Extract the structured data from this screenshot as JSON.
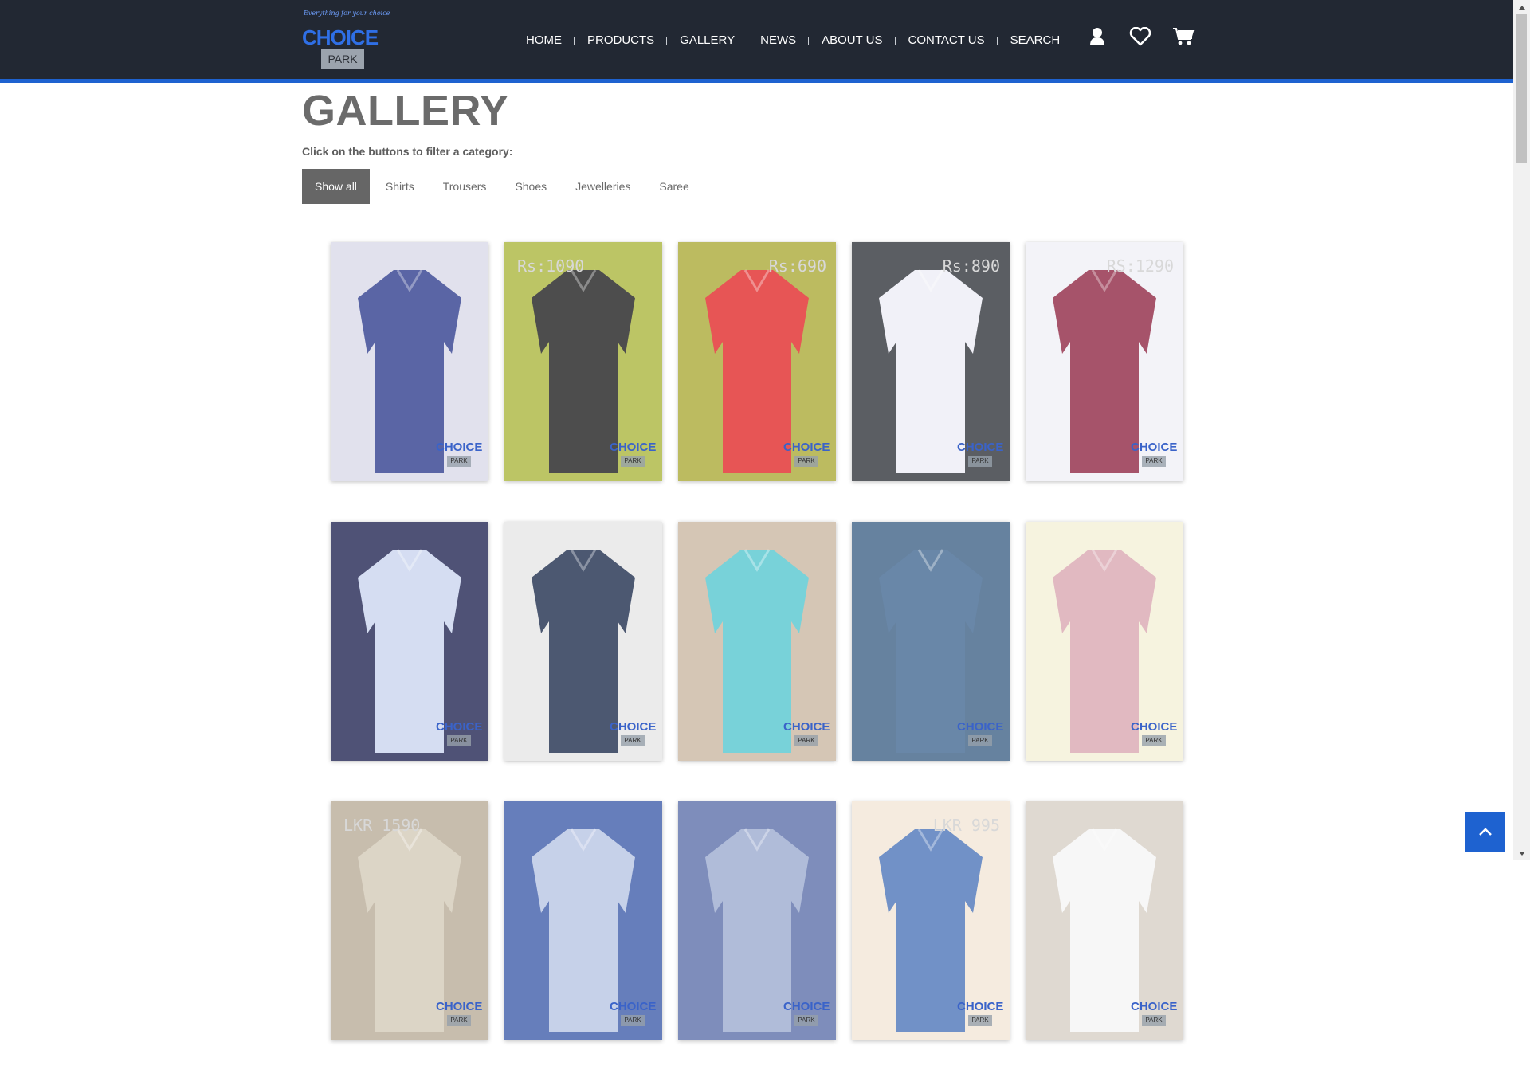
{
  "brand": {
    "tagline": "Everything for your choice",
    "name_primary": "CHOICE",
    "name_secondary": "PARK"
  },
  "nav": {
    "items": [
      {
        "label": "HOME"
      },
      {
        "label": "PRODUCTS"
      },
      {
        "label": "GALLERY"
      },
      {
        "label": "NEWS"
      },
      {
        "label": "ABOUT US"
      },
      {
        "label": "CONTACT US"
      },
      {
        "label": "SEARCH"
      }
    ],
    "icons": [
      "user-icon",
      "heart-icon",
      "cart-icon"
    ]
  },
  "page": {
    "title": "GALLERY",
    "filter_prompt": "Click on the buttons to filter a category:",
    "filters": [
      {
        "label": "Show all",
        "active": true
      },
      {
        "label": "Shirts",
        "active": false
      },
      {
        "label": "Trousers",
        "active": false
      },
      {
        "label": "Shoes",
        "active": false
      },
      {
        "label": "Jewelleries",
        "active": false
      },
      {
        "label": "Saree",
        "active": false
      }
    ]
  },
  "gallery": {
    "rows": [
      [
        {
          "name": "floral-blue-shirt",
          "price": "",
          "bg": "#d9d9e8",
          "shirt": "#2c3a8c"
        },
        {
          "name": "black-dotted-shirt",
          "price": "Rs:1090",
          "bg": "#aab53a",
          "shirt": "#1c1c1c"
        },
        {
          "name": "red-big-hero-tshirt",
          "price": "Rs:690",
          "bg": "#a9a834",
          "shirt": "#e02626"
        },
        {
          "name": "white-formal-shirt",
          "price": "Rs:890",
          "bg": "#2d3138",
          "shirt": "#eeeef6"
        },
        {
          "name": "maroon-blue-polo",
          "price": "RS:1290",
          "bg": "#f0f0f6",
          "shirt": "#8e2340"
        }
      ],
      [
        {
          "name": "printed-white-tshirt",
          "price": "",
          "bg": "#1e2250",
          "shirt": "#c9d4ef"
        },
        {
          "name": "navy-jacket-model",
          "price": "",
          "bg": "#e6e6e6",
          "shirt": "#1a2a4a"
        },
        {
          "name": "turquoise-kurta",
          "price": "",
          "bg": "#c9b6a0",
          "shirt": "#53c6cf"
        },
        {
          "name": "denim-shirt",
          "price": "",
          "bg": "#3c5f85",
          "shirt": "#3f6690"
        },
        {
          "name": "checked-shirt-poster",
          "price": "",
          "bg": "#f4f0d6",
          "shirt": "#d9a6b0"
        }
      ],
      [
        {
          "name": "beige-shirt",
          "price": "LKR 1590",
          "bg": "#b8ab96",
          "shirt": "#d3c9b6"
        },
        {
          "name": "shop-display-1",
          "price": "",
          "bg": "#3b5aa8",
          "shirt": "#b7c4e3"
        },
        {
          "name": "shop-display-2",
          "price": "",
          "bg": "#5a6ea8",
          "shirt": "#9aa9cf"
        },
        {
          "name": "blue-shirt-mannequin",
          "price": "LKR 995",
          "bg": "#f2e6d6",
          "shirt": "#4a73b8"
        },
        {
          "name": "white-shirt-sleeves",
          "price": "",
          "bg": "#d7cfc5",
          "shirt": "#f5f5f5"
        }
      ]
    ],
    "watermark_primary": "CHOICE",
    "watermark_secondary": "PARK"
  },
  "back_to_top_icon": "chevron-up-icon",
  "colors": {
    "header_bg": "#222833",
    "accent": "#1e62d0",
    "active_filter": "#666666",
    "title": "#6b6b6b"
  }
}
